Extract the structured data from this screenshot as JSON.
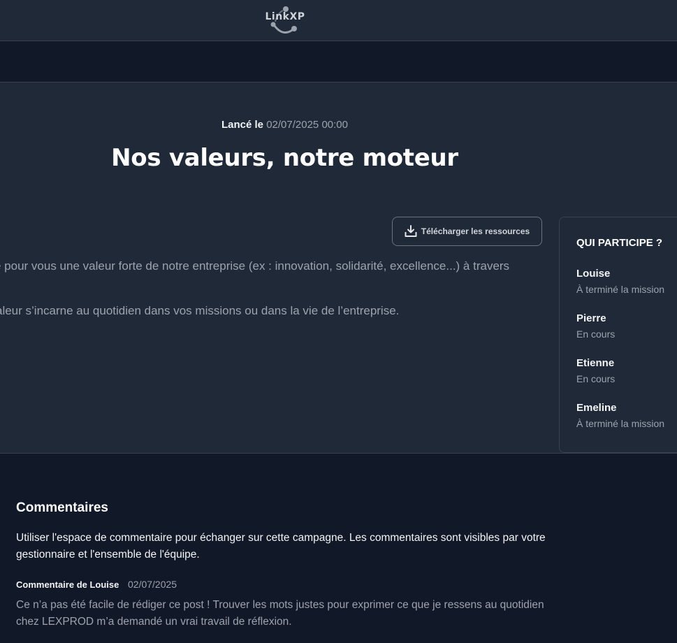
{
  "header": {
    "logo_text": "LinkXP"
  },
  "campaign": {
    "launched_label": "Lancé le",
    "launched_date": "02/07/2025 00:00",
    "title": "Nos valeurs, notre moteur",
    "download_label": "Télécharger les ressources",
    "description_lines": [
      "e pour vous une valeur forte de notre entreprise (ex : innovation, solidarité, excellence...) à travers",
      "aleur s’incarne au quotidien dans vos missions ou dans la vie de l’entreprise."
    ]
  },
  "participants": {
    "title": "QUI PARTICIPE ?",
    "items": [
      {
        "name": "Louise",
        "status": "À terminé la mission"
      },
      {
        "name": "Pierre",
        "status": "En cours"
      },
      {
        "name": "Etienne",
        "status": "En cours"
      },
      {
        "name": "Emeline",
        "status": "À terminé la mission"
      }
    ]
  },
  "comments": {
    "title": "Commentaires",
    "intro": "Utiliser l'espace de commentaire pour échanger sur cette campagne. Les commentaires sont visibles par votre gestionnaire et l'ensemble de l'équipe.",
    "items": [
      {
        "author_label": "Commentaire de Louise",
        "date": "02/07/2025",
        "body": "Ce n’a pas été facile de rédiger ce post ! Trouver les mots justes pour exprimer ce que je ressens au quotidien chez LEXPROD m’a demandé un vrai travail de réflexion."
      }
    ]
  },
  "icons": {
    "logo": "linkxp-logo-icon",
    "download": "download-icon"
  },
  "colors": {
    "page_bg": "#111827",
    "panel_bg": "#1f2937",
    "border": "#374151",
    "muted_text": "#9ca3af"
  }
}
